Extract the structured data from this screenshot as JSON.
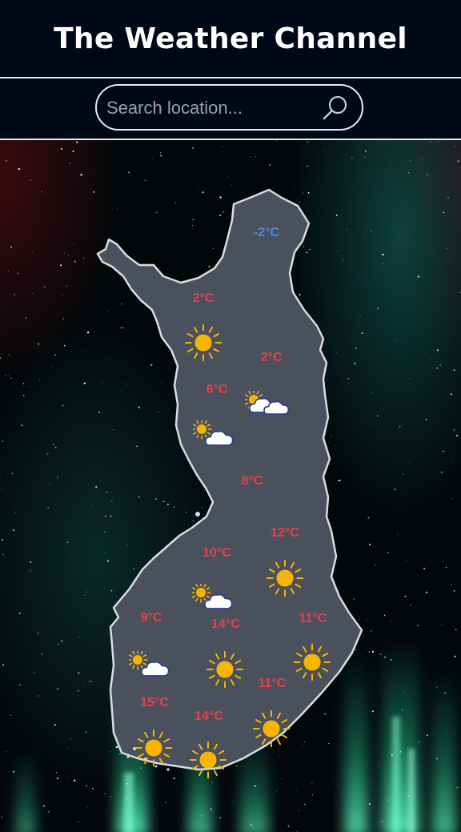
{
  "app": {
    "title": "The Weather Channel"
  },
  "search": {
    "placeholder": "Search location...",
    "value": ""
  },
  "colors": {
    "header_bg": "#010818",
    "map_fill": "#4a505c",
    "temp_warm": "#e8424a",
    "temp_cold": "#4a90e2",
    "sun": "#f7b500",
    "cloud": "#ffffff",
    "aurora": "#3ee8a8"
  },
  "forecast": [
    {
      "temp": "-2°C",
      "condition": "none",
      "color": "#4a90e2"
    },
    {
      "temp": "2°C",
      "condition": "sunny",
      "color": "#e8424a"
    },
    {
      "temp": "2°C",
      "condition": "partly-cloudy",
      "color": "#e8424a"
    },
    {
      "temp": "6°C",
      "condition": "partly-cloudy",
      "color": "#e8424a"
    },
    {
      "temp": "8°C",
      "condition": "none",
      "color": "#e8424a"
    },
    {
      "temp": "12°C",
      "condition": "sunny",
      "color": "#e8424a"
    },
    {
      "temp": "10°C",
      "condition": "partly-cloudy",
      "color": "#e8424a"
    },
    {
      "temp": "9°C",
      "condition": "partly-cloudy",
      "color": "#e8424a"
    },
    {
      "temp": "14°C",
      "condition": "sunny",
      "color": "#e8424a"
    },
    {
      "temp": "11°C",
      "condition": "sunny",
      "color": "#e8424a"
    },
    {
      "temp": "11°C",
      "condition": "sunny",
      "color": "#e8424a"
    },
    {
      "temp": "15°C",
      "condition": "sunny",
      "color": "#e8424a"
    },
    {
      "temp": "14°C",
      "condition": "sunny",
      "color": "#e8424a"
    }
  ]
}
